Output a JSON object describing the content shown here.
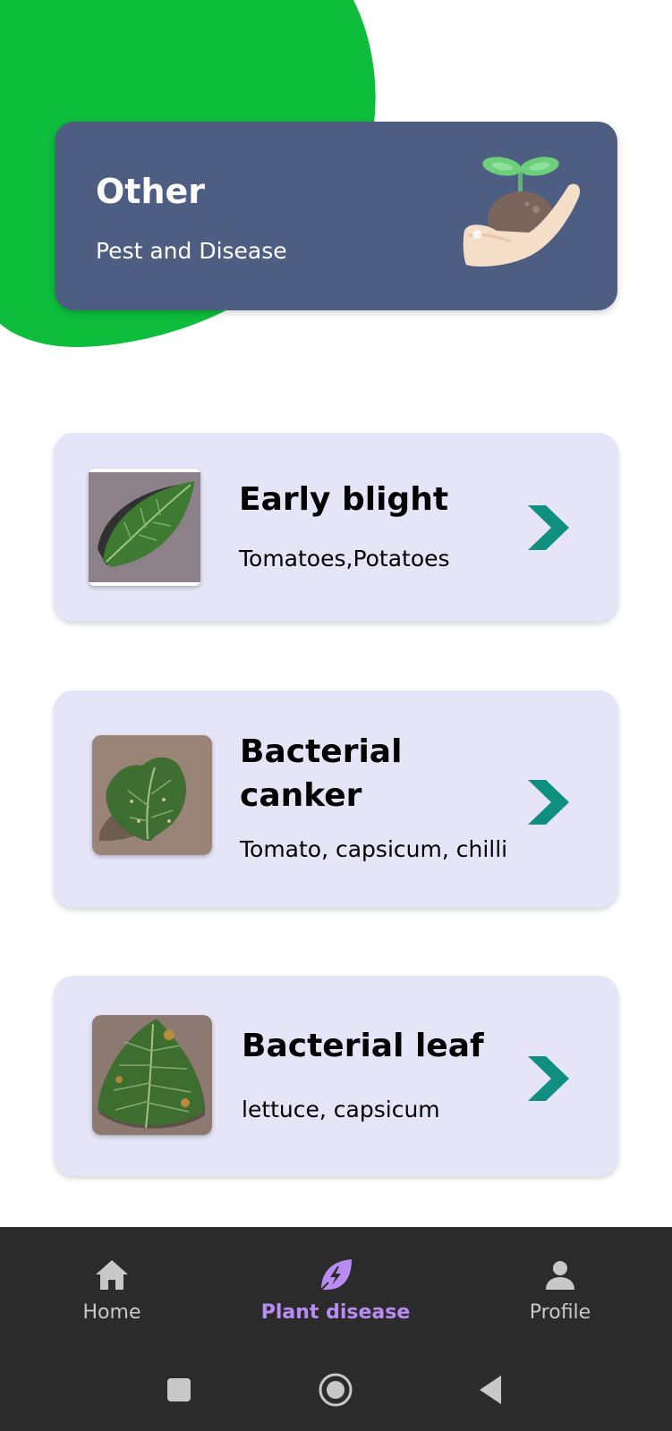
{
  "header": {
    "title": "Other",
    "subtitle": "Pest and Disease",
    "illustration_icon": "plant-sprout-in-hand-icon"
  },
  "diseases": [
    {
      "title": "Early blight",
      "subtitle": "Tomatoes,Potatoes",
      "action_icon": "chevron-right-icon"
    },
    {
      "title": "Bacterial canker",
      "subtitle": "Tomato, capsicum, chilli",
      "action_icon": "chevron-right-icon"
    },
    {
      "title": "Bacterial leaf",
      "subtitle": "lettuce, capsicum",
      "action_icon": "chevron-right-icon"
    }
  ],
  "bottom_nav": {
    "items": [
      {
        "label": "Home",
        "icon": "home-icon",
        "active": false
      },
      {
        "label": "Plant disease",
        "icon": "leaf-bolt-icon",
        "active": true
      },
      {
        "label": "Profile",
        "icon": "person-icon",
        "active": false
      }
    ]
  },
  "system_nav": {
    "buttons": [
      "recents-icon",
      "home-circle-icon",
      "back-icon"
    ]
  },
  "colors": {
    "header_card": "#4e5d82",
    "disease_card": "#e6e5f8",
    "accent_green": "#0dbd3b",
    "chevron": "#0f8f80",
    "nav_active": "#b98cf2",
    "nav_inactive": "#c8c8c8",
    "nav_background": "#2b2b2b"
  }
}
